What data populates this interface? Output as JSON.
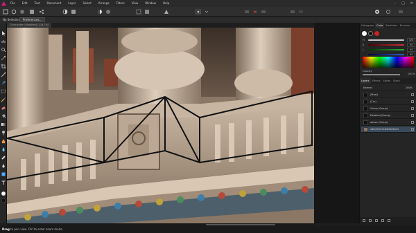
{
  "menubar": {
    "items": [
      "File",
      "Edit",
      "Text",
      "Document",
      "Layer",
      "Select",
      "Arrange",
      "Filters",
      "View",
      "Window",
      "Help"
    ]
  },
  "context": {
    "selection_text": "No Selection",
    "preferences_label": "Preferences..."
  },
  "document": {
    "tab_label": "Churrisafari [Modified] (118.7%)"
  },
  "panel": {
    "tabs": [
      "Histogram",
      "Color",
      "Swatches",
      "Brushes"
    ],
    "sliders": [
      {
        "label": "H",
        "value": "326",
        "color": "#c8c8c8"
      },
      {
        "label": "S",
        "value": "94",
        "color": "#d03040"
      },
      {
        "label": "L",
        "value": "94",
        "color": "#30b040"
      },
      {
        "label": "",
        "value": "95",
        "color": "#3060d0"
      }
    ],
    "opacity_label": "Opacity",
    "opacity_value": "100 %"
  },
  "layers": {
    "tabs": [
      "Layers",
      "Effects",
      "Styles",
      "Stock"
    ],
    "rows": [
      {
        "name": "Normal",
        "opacity": "100%",
        "type": "blend"
      },
      {
        "name": "(Pixel)",
        "type": "pixel"
      },
      {
        "name": "(Crv)",
        "type": "curve"
      },
      {
        "name": "Group (Group)",
        "type": "group"
      },
      {
        "name": "Detailed (Group)",
        "type": "group"
      },
      {
        "name": "above (Group)",
        "type": "group"
      },
      {
        "name": "a6fe/9/3e3c8df2bf4b21",
        "type": "image",
        "selected": true
      }
    ]
  },
  "status": {
    "prefix": "Drag",
    "text": " to pan view. Ctrl to enter zoom mode."
  }
}
